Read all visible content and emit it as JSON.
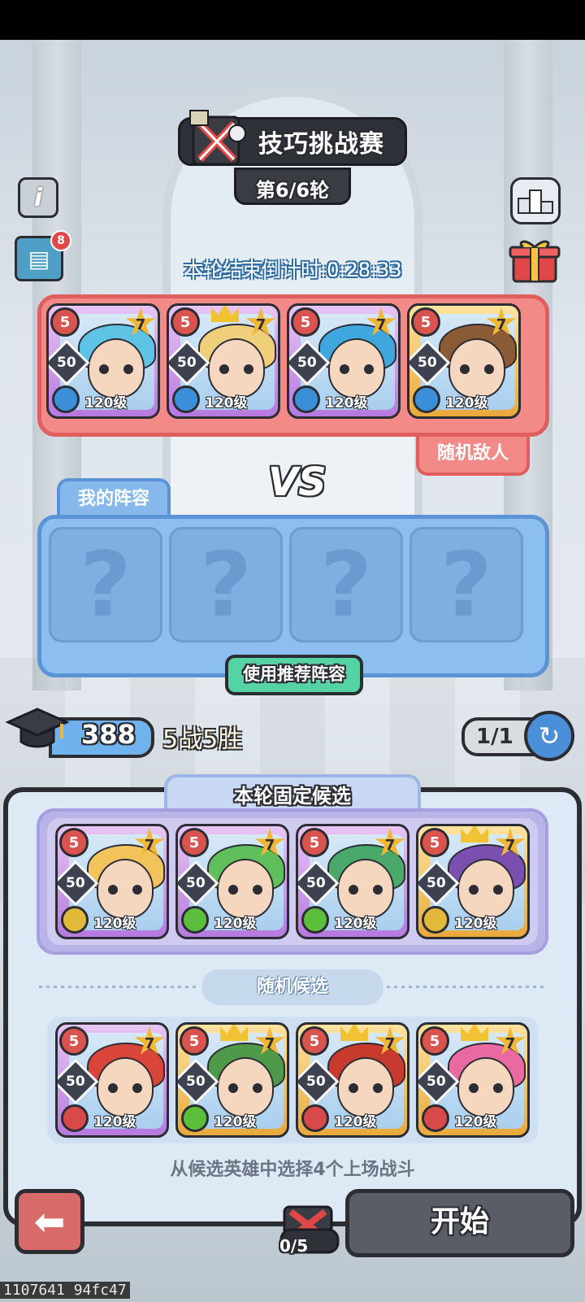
{
  "header": {
    "title": "技巧挑战赛",
    "round": "第6/6轮",
    "countdown": "本轮结束倒计时:0:28:33"
  },
  "side_buttons": {
    "info_icon": "i",
    "quest_badge": "8"
  },
  "enemy": {
    "tag": "随机敌人",
    "heroes": [
      {
        "rank": "5",
        "stars": "7",
        "level": "50",
        "grade": "120级",
        "frame": "purple",
        "element_color": "#3a8fd8",
        "hair": "#5fc3e6",
        "crown": false
      },
      {
        "rank": "5",
        "stars": "7",
        "level": "50",
        "grade": "120级",
        "frame": "purple",
        "element_color": "#3a8fd8",
        "hair": "#f0cf7a",
        "crown": true
      },
      {
        "rank": "5",
        "stars": "7",
        "level": "50",
        "grade": "120级",
        "frame": "purple",
        "element_color": "#3a8fd8",
        "hair": "#3fa6de",
        "crown": false
      },
      {
        "rank": "5",
        "stars": "7",
        "level": "50",
        "grade": "120级",
        "frame": "gold",
        "element_color": "#3a8fd8",
        "hair": "#8b5a36",
        "crown": false
      }
    ]
  },
  "vs_label": "VS",
  "my_lineup": {
    "tab": "我的阵容",
    "slots": [
      "?",
      "?",
      "?",
      "?"
    ],
    "recommend_button": "使用推荐阵容"
  },
  "stats": {
    "exp": "388",
    "record": "5战5胜",
    "refresh": "1/1"
  },
  "fixed": {
    "tab": "本轮固定候选",
    "heroes": [
      {
        "rank": "5",
        "stars": "7",
        "level": "50",
        "grade": "120级",
        "frame": "purple",
        "element_color": "#e2b93b",
        "hair": "#f2c35a",
        "crown": false
      },
      {
        "rank": "5",
        "stars": "7",
        "level": "50",
        "grade": "120级",
        "frame": "purple",
        "element_color": "#5bbf3c",
        "hair": "#5fbf5a",
        "crown": false
      },
      {
        "rank": "5",
        "stars": "7",
        "level": "50",
        "grade": "120级",
        "frame": "purple",
        "element_color": "#5bbf3c",
        "hair": "#4aa86b",
        "crown": false
      },
      {
        "rank": "5",
        "stars": "7",
        "level": "50",
        "grade": "120级",
        "frame": "gold",
        "element_color": "#e2b93b",
        "hair": "#7a4fb0",
        "crown": true
      }
    ]
  },
  "random": {
    "label": "随机候选",
    "heroes": [
      {
        "rank": "5",
        "stars": "7",
        "level": "50",
        "grade": "120级",
        "frame": "purple",
        "element_color": "#d84a4a",
        "hair": "#d9453b",
        "crown": false
      },
      {
        "rank": "5",
        "stars": "7",
        "level": "50",
        "grade": "120级",
        "frame": "gold",
        "element_color": "#5bbf3c",
        "hair": "#4e9a4a",
        "crown": true
      },
      {
        "rank": "5",
        "stars": "7",
        "level": "50",
        "grade": "120级",
        "frame": "gold",
        "element_color": "#d84a4a",
        "hair": "#c83a2e",
        "crown": true
      },
      {
        "rank": "5",
        "stars": "7",
        "level": "50",
        "grade": "120级",
        "frame": "gold",
        "element_color": "#d84a4a",
        "hair": "#e86aa0",
        "crown": true
      }
    ]
  },
  "hint": "从候选英雄中选择4个上场战斗",
  "bottom": {
    "start": "开始",
    "selected_count": "0/5"
  },
  "footer_id": "1107641 94fc47"
}
